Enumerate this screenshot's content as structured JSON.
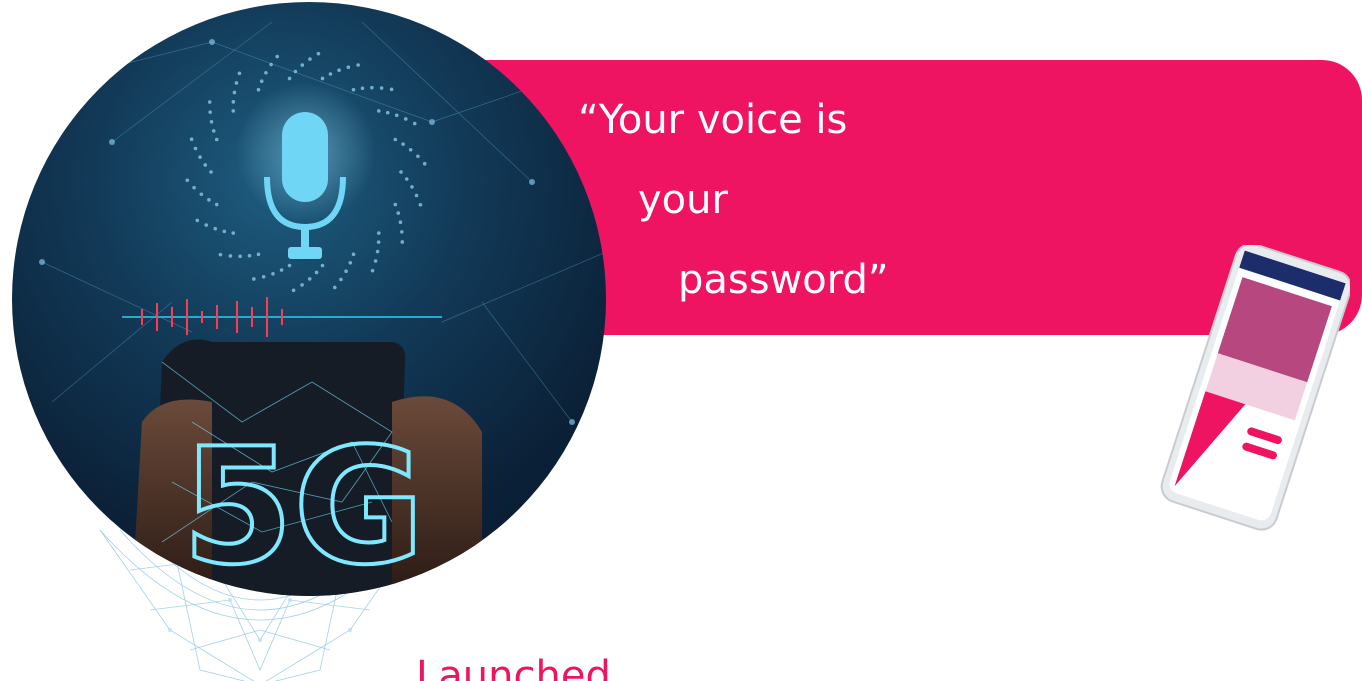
{
  "banner": {
    "quote_line_1": "“Your voice is",
    "quote_line_2": "your",
    "quote_line_3": "password”",
    "color": "#ee1462"
  },
  "hero": {
    "badge_text": "5G",
    "icon": "microphone-icon"
  },
  "caption": {
    "text": "Launched"
  },
  "colors": {
    "accent": "#ee1462",
    "hero_dark": "#0b2138",
    "wave_pink": "#f5a3c7",
    "wave_purple": "#a99ee0",
    "wave_cyan": "#3fd0d6"
  }
}
